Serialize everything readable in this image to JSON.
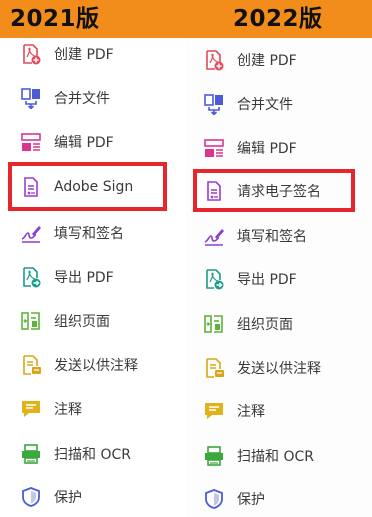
{
  "header": {
    "left_year": "2021版",
    "right_year": "2022版"
  },
  "colors": {
    "header_bg": "#f28c1b",
    "highlight": "#e5262c"
  },
  "left_tools": [
    {
      "label": "创建 PDF",
      "icon": "create-pdf-icon"
    },
    {
      "label": "合并文件",
      "icon": "combine-files-icon"
    },
    {
      "label": "编辑 PDF",
      "icon": "edit-pdf-icon"
    },
    {
      "label": "Adobe Sign",
      "icon": "request-esign-icon",
      "highlighted": true
    },
    {
      "label": "填写和签名",
      "icon": "fill-sign-icon"
    },
    {
      "label": "导出 PDF",
      "icon": "export-pdf-icon"
    },
    {
      "label": "组织页面",
      "icon": "organize-pages-icon"
    },
    {
      "label": "发送以供注释",
      "icon": "send-comments-icon"
    },
    {
      "label": "注释",
      "icon": "comment-icon"
    },
    {
      "label": "扫描和 OCR",
      "icon": "scan-ocr-icon"
    },
    {
      "label": "保护",
      "icon": "protect-icon"
    }
  ],
  "right_tools": [
    {
      "label": "创建 PDF",
      "icon": "create-pdf-icon"
    },
    {
      "label": "合并文件",
      "icon": "combine-files-icon"
    },
    {
      "label": "编辑 PDF",
      "icon": "edit-pdf-icon"
    },
    {
      "label": "请求电子签名",
      "icon": "request-esign-icon",
      "highlighted": true
    },
    {
      "label": "填写和签名",
      "icon": "fill-sign-icon"
    },
    {
      "label": "导出 PDF",
      "icon": "export-pdf-icon"
    },
    {
      "label": "组织页面",
      "icon": "organize-pages-icon"
    },
    {
      "label": "发送以供注释",
      "icon": "send-comments-icon"
    },
    {
      "label": "注释",
      "icon": "comment-icon"
    },
    {
      "label": "扫描和 OCR",
      "icon": "scan-ocr-icon"
    },
    {
      "label": "保护",
      "icon": "protect-icon"
    }
  ]
}
